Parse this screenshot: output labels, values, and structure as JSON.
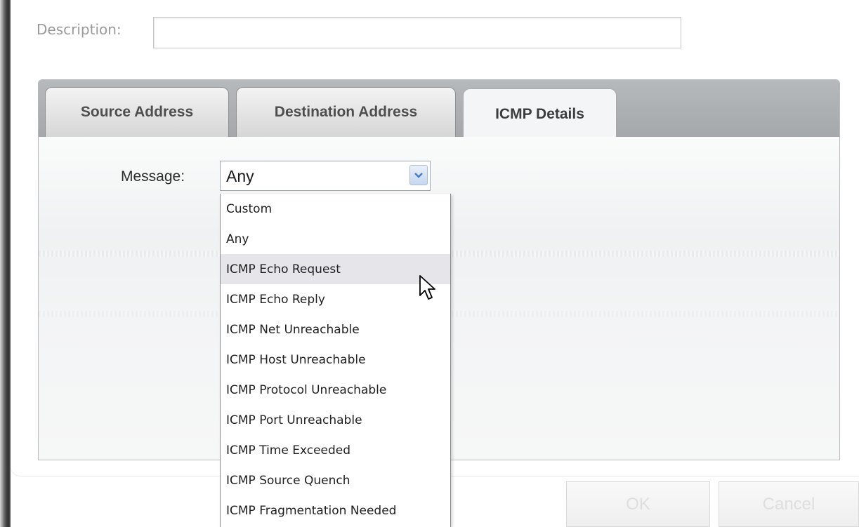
{
  "description": {
    "label": "Description:",
    "value": ""
  },
  "tabs": [
    {
      "label": "Source Address",
      "active": false
    },
    {
      "label": "Destination Address",
      "active": false
    },
    {
      "label": "ICMP Details",
      "active": true
    }
  ],
  "message": {
    "label": "Message:",
    "selected": "Any",
    "options": [
      "Custom",
      "Any",
      "ICMP Echo Request",
      "ICMP Echo Reply",
      "ICMP Net Unreachable",
      "ICMP Host Unreachable",
      "ICMP Protocol Unreachable",
      "ICMP Port Unreachable",
      "ICMP Time Exceeded",
      "ICMP Source Quench",
      "ICMP Fragmentation Needed"
    ],
    "hovered_option": "ICMP Echo Request"
  },
  "buttons": {
    "ok": "OK",
    "cancel": "Cancel"
  },
  "icons": {
    "dropdown_arrow": "chevron-down-icon",
    "cursor": "mouse-pointer-icon"
  },
  "colors": {
    "tab_header": "#b6b9bb",
    "hover_row": "#e6e6ea",
    "select_arrow": "#4a7fc7"
  }
}
